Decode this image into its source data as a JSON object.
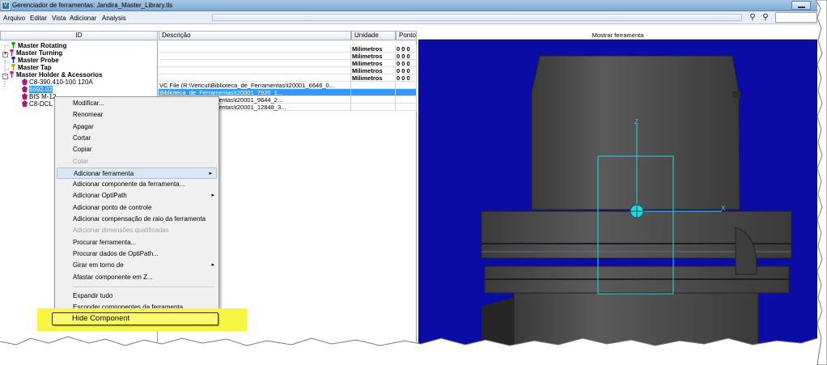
{
  "window": {
    "title": "Gerenciador de ferramentas: Jandira_Master_Library.tls",
    "app_icon": "V"
  },
  "menubar": {
    "items": [
      "Arquivo",
      "Editar",
      "Vista",
      "Adicionar",
      "Analysis"
    ]
  },
  "tree": {
    "header": "ID",
    "items": [
      {
        "label": "Master Rotating",
        "bold": true,
        "icon_color": "#1a9a1a"
      },
      {
        "label": "Master Turning",
        "bold": true,
        "icon_color": "#d21f8a",
        "expander": "+"
      },
      {
        "label": "Master Probe",
        "bold": true,
        "icon_color": "#1a2ad2"
      },
      {
        "label": "Master Tap",
        "bold": true,
        "icon_color": "#c9a400"
      },
      {
        "label": "Master Holder & Acessorios",
        "bold": true,
        "icon_color": "#d21f8a",
        "expander": "-"
      },
      {
        "label": "C8-390.410-100 120A",
        "bold": false,
        "icon_color": "#b0127a"
      },
      {
        "label": "6692.02",
        "bold": false,
        "icon_color": "#b0127a",
        "selected": true
      },
      {
        "label": "BIS M-12",
        "bold": false,
        "icon_color": "#b0127a"
      },
      {
        "label": "C8-DCL",
        "bold": false,
        "icon_color": "#b0127a"
      }
    ]
  },
  "table": {
    "headers": [
      "Descrição",
      "Unidade",
      "Ponto"
    ],
    "rows": [
      {
        "desc": "",
        "unit": "Milimetros",
        "ponto": "0 0 0"
      },
      {
        "desc": "",
        "unit": "Milimetros",
        "ponto": "0 0 0"
      },
      {
        "desc": "",
        "unit": "Milimetros",
        "ponto": "0 0 0"
      },
      {
        "desc": "",
        "unit": "Milimetros",
        "ponto": "0 0 0"
      },
      {
        "desc": "",
        "unit": "Milimetros",
        "ponto": "0 0 0"
      },
      {
        "desc": "VC File (R:\\Vericut\\Biblioteca_de_Ferramentas\\t20001_6646_0...",
        "unit": "",
        "ponto": ""
      },
      {
        "desc": "Biblioteca_de_Ferramentas\\t20001_7920_1...",
        "unit": "",
        "ponto": "",
        "selected": true
      },
      {
        "desc": "Biblioteca_de_Ferramentas\\t20001_9644_2...",
        "unit": "",
        "ponto": ""
      },
      {
        "desc": "Biblioteca_de_Ferramentas\\t20001_12848_3...",
        "unit": "",
        "ponto": ""
      }
    ]
  },
  "viewer": {
    "header": "Mostrar ferramenta",
    "axis_z": "Z",
    "axis_x": "X",
    "background": "#0b0ba6",
    "tool_color": "#4a4a4a",
    "box_color": "#22d8e0"
  },
  "context_menu": {
    "items": [
      {
        "label": "Modificar..."
      },
      {
        "label": "Renomear"
      },
      {
        "label": "Apagar"
      },
      {
        "label": "Cortar"
      },
      {
        "label": "Copiar"
      },
      {
        "label": "Colar",
        "disabled": true
      },
      {
        "label": "Adicionar ferramenta",
        "submenu": true,
        "hover": true
      },
      {
        "label": "Adicionar componente da ferramenta..."
      },
      {
        "label": "Adicionar OptiPath",
        "submenu": true
      },
      {
        "label": "Adicionar ponto de controle"
      },
      {
        "label": "Adicionar compensação de raio da ferramenta"
      },
      {
        "label": "Adicionar dimensões qualificadas",
        "disabled": true
      },
      {
        "label": "Procurar ferramenta..."
      },
      {
        "label": "Procurar dados de OptiPath..."
      },
      {
        "label": "Girar em torno de",
        "submenu": true
      },
      {
        "label": "Afastar componente em Z..."
      },
      {
        "label": "Expandir tudo",
        "separator_before": true
      },
      {
        "label": "Esconder componentes da ferramenta"
      }
    ],
    "submenu_arrow": "▸"
  },
  "callout": {
    "label": "Hide Component",
    "highlight_color": "#f7f743"
  }
}
